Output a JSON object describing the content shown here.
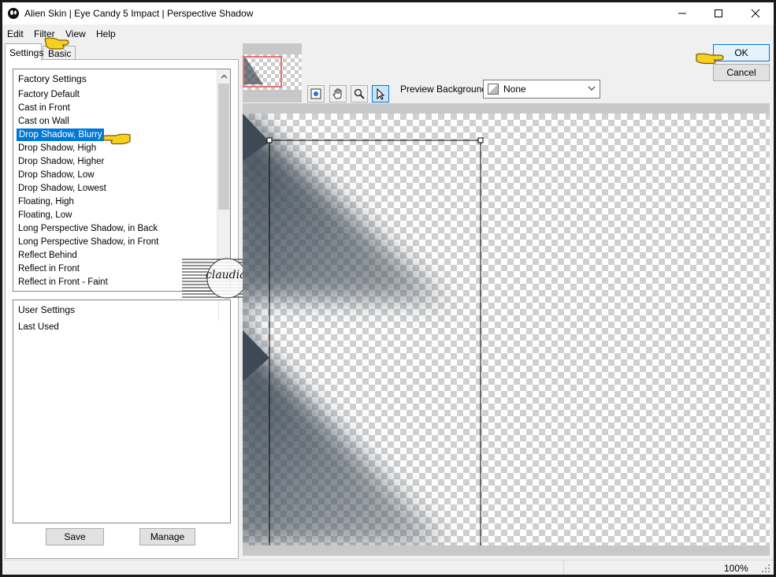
{
  "window": {
    "title": "Alien Skin | Eye Candy 5 Impact | Perspective Shadow"
  },
  "menu": {
    "edit": "Edit",
    "filter": "Filter",
    "view": "View",
    "help": "Help"
  },
  "tabs": {
    "settings": "Settings",
    "basic": "Basic"
  },
  "factory": {
    "header": "Factory Settings",
    "items": [
      "Factory Default",
      "Cast in Front",
      "Cast on Wall",
      "Drop Shadow, Blurry",
      "Drop Shadow, High",
      "Drop Shadow, Higher",
      "Drop Shadow, Low",
      "Drop Shadow, Lowest",
      "Floating, High",
      "Floating, Low",
      "Long Perspective Shadow, in Back",
      "Long Perspective Shadow, in Front",
      "Reflect Behind",
      "Reflect in Front",
      "Reflect in Front - Faint"
    ],
    "selected": "Drop Shadow, Blurry"
  },
  "user": {
    "header": "User Settings",
    "items": [
      "Last Used"
    ]
  },
  "buttons": {
    "save": "Save",
    "manage": "Manage",
    "ok": "OK",
    "cancel": "Cancel"
  },
  "preview": {
    "background_label": "Preview Background:",
    "background_value": "None"
  },
  "status": {
    "zoom": "100%"
  },
  "watermark": {
    "text": "claudia"
  },
  "colors": {
    "selection": "#0078d7",
    "shadow": "#3d4a55",
    "pointer_hand": "#f5d020",
    "thumb_frame": "#e57373"
  },
  "icons": [
    "app-icon",
    "minimize-icon",
    "maximize-icon",
    "close-icon",
    "chevron-up-icon",
    "chevron-down-icon",
    "navigator-icon",
    "hand-icon",
    "zoom-icon",
    "arrow-pointer-icon",
    "pointing-hand-icon",
    "resize-grip-icon"
  ]
}
